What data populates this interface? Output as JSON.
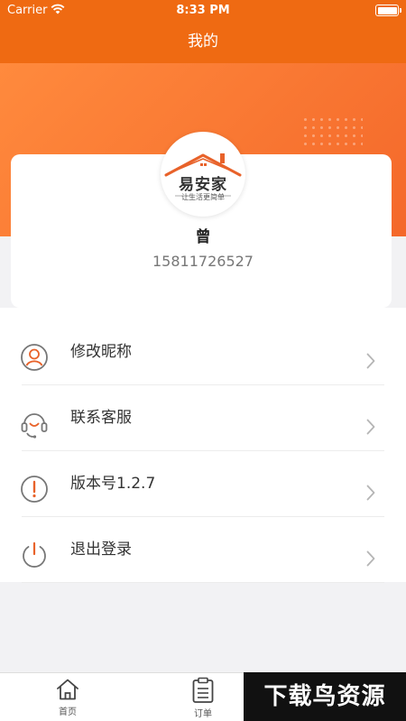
{
  "status_bar": {
    "carrier": "Carrier",
    "time": "8:33 PM"
  },
  "header": {
    "title": "我的"
  },
  "logo": {
    "brand": "易安家",
    "slogan": "让生活更简单"
  },
  "user": {
    "name": "曾",
    "phone": "15811726527"
  },
  "menu": [
    {
      "label": "修改昵称",
      "icon": "user-icon"
    },
    {
      "label": "联系客服",
      "icon": "headset-icon"
    },
    {
      "label": "版本号1.2.7",
      "icon": "info-icon"
    },
    {
      "label": "退出登录",
      "icon": "power-icon"
    }
  ],
  "tabs": [
    {
      "label": "首页",
      "icon": "home-icon"
    },
    {
      "label": "订单",
      "icon": "clipboard-icon"
    }
  ],
  "watermark": "下载鸟资源",
  "colors": {
    "accent": "#ef6a12",
    "icon_gray": "#777777",
    "icon_orange": "#e8622a"
  }
}
